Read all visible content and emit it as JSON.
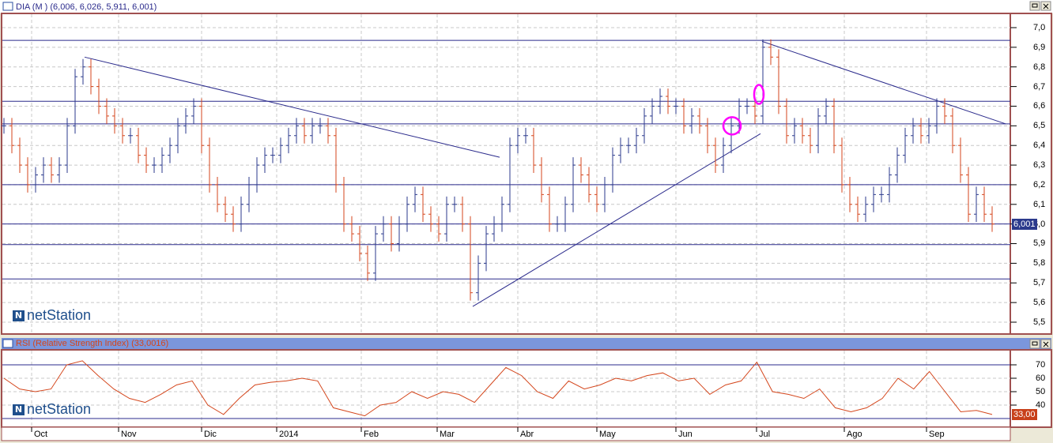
{
  "price_panel": {
    "title": "DIA (M ) (6,006, 6,026, 5,911, 6,001)",
    "last_value_badge": "6,001",
    "logo_text": "netStation"
  },
  "rsi_panel": {
    "title": "RSI (Relative Strength Index) (33,0016)",
    "last_value_badge": "33,00",
    "logo_text": "netStation"
  },
  "colors": {
    "up": "#2b3a8c",
    "down": "#d4461c",
    "line": "#2b2b8c",
    "rsi": "#d4461c",
    "marker": "#ff00ff",
    "badge_price": "#2b3a8c",
    "badge_rsi": "#c8401a",
    "frame": "#a05050",
    "rsi_title_bg": "#7b96dc"
  },
  "chart_data": [
    {
      "type": "ohlc",
      "title": "DIA (M )",
      "ylim": [
        5.45,
        7.05
      ],
      "y_ticks": [
        "5,5",
        "5,6",
        "5,7",
        "5,8",
        "5,9",
        "6,0",
        "6,1",
        "6,2",
        "6,3",
        "6,4",
        "6,5",
        "6,6",
        "6,7",
        "6,8",
        "6,9",
        "7,0"
      ],
      "y_tick_values": [
        5.5,
        5.6,
        5.7,
        5.8,
        5.9,
        6.0,
        6.1,
        6.2,
        6.3,
        6.4,
        6.5,
        6.6,
        6.7,
        6.8,
        6.9,
        7.0
      ],
      "x_tick_labels": [
        "Oct",
        "Nov",
        "Dic",
        "2014",
        "Feb",
        "Mar",
        "Abr",
        "May",
        "Jun",
        "Jul",
        "Ago",
        "Sep"
      ],
      "x_tick_index": [
        3.5,
        14.5,
        25,
        34.5,
        45.2,
        54.8,
        65,
        75,
        85,
        95.2,
        106.3,
        116.7
      ],
      "closes": [
        6.5,
        6.4,
        6.3,
        6.2,
        6.25,
        6.3,
        6.25,
        6.3,
        6.5,
        6.75,
        6.8,
        6.7,
        6.6,
        6.55,
        6.5,
        6.45,
        6.45,
        6.35,
        6.3,
        6.3,
        6.35,
        6.4,
        6.5,
        6.55,
        6.6,
        6.4,
        6.2,
        6.1,
        6.05,
        6.0,
        6.1,
        6.2,
        6.3,
        6.35,
        6.35,
        6.4,
        6.45,
        6.5,
        6.45,
        6.5,
        6.5,
        6.45,
        6.2,
        6.0,
        5.95,
        5.85,
        5.75,
        5.95,
        6.0,
        5.9,
        6.0,
        6.1,
        6.15,
        6.05,
        6.0,
        5.95,
        6.1,
        6.1,
        6.0,
        5.65,
        5.8,
        5.95,
        6.0,
        6.1,
        6.4,
        6.45,
        6.45,
        6.3,
        6.15,
        6.0,
        6.0,
        6.1,
        6.3,
        6.25,
        6.15,
        6.1,
        6.2,
        6.35,
        6.4,
        6.4,
        6.45,
        6.55,
        6.6,
        6.65,
        6.6,
        6.6,
        6.5,
        6.55,
        6.5,
        6.4,
        6.3,
        6.4,
        6.5,
        6.6,
        6.6,
        6.55,
        6.9,
        6.85,
        6.6,
        6.45,
        6.5,
        6.45,
        6.4,
        6.55,
        6.6,
        6.4,
        6.2,
        6.1,
        6.05,
        6.1,
        6.15,
        6.15,
        6.25,
        6.35,
        6.45,
        6.5,
        6.45,
        6.5,
        6.6,
        6.55,
        6.4,
        6.25,
        6.05,
        6.15,
        6.05,
        6.0
      ],
      "horizontal_levels": [
        6.935,
        6.625,
        6.51,
        6.2,
        6.0,
        5.895,
        5.72
      ],
      "trendlines": [
        {
          "from": [
            10.2,
            6.85
          ],
          "to": [
            62.7,
            6.34
          ]
        },
        {
          "from": [
            59.3,
            5.58
          ],
          "to": [
            95.7,
            6.46
          ]
        },
        {
          "from": [
            95.9,
            6.93
          ],
          "to": [
            126.7,
            6.51
          ]
        }
      ],
      "markers": [
        {
          "at": [
            92.1,
            6.5
          ]
        },
        {
          "at": [
            95.5,
            6.66
          ]
        }
      ]
    },
    {
      "type": "line",
      "title": "RSI (Relative Strength Index)",
      "ylim": [
        23,
        81
      ],
      "y_ticks": [
        "40",
        "50",
        "60",
        "70"
      ],
      "y_tick_values": [
        40,
        50,
        60,
        70
      ],
      "levels": [
        70,
        30
      ],
      "values": [
        60,
        52,
        50,
        52,
        70,
        73,
        62,
        52,
        45,
        42,
        48,
        55,
        58,
        40,
        33,
        45,
        55,
        57,
        58,
        60,
        58,
        38,
        35,
        32,
        40,
        42,
        50,
        45,
        50,
        48,
        42,
        55,
        68,
        62,
        50,
        45,
        58,
        52,
        55,
        60,
        58,
        62,
        64,
        58,
        60,
        48,
        55,
        58,
        72,
        50,
        48,
        45,
        52,
        38,
        35,
        38,
        45,
        60,
        52,
        65,
        50,
        35,
        36,
        33
      ]
    }
  ]
}
